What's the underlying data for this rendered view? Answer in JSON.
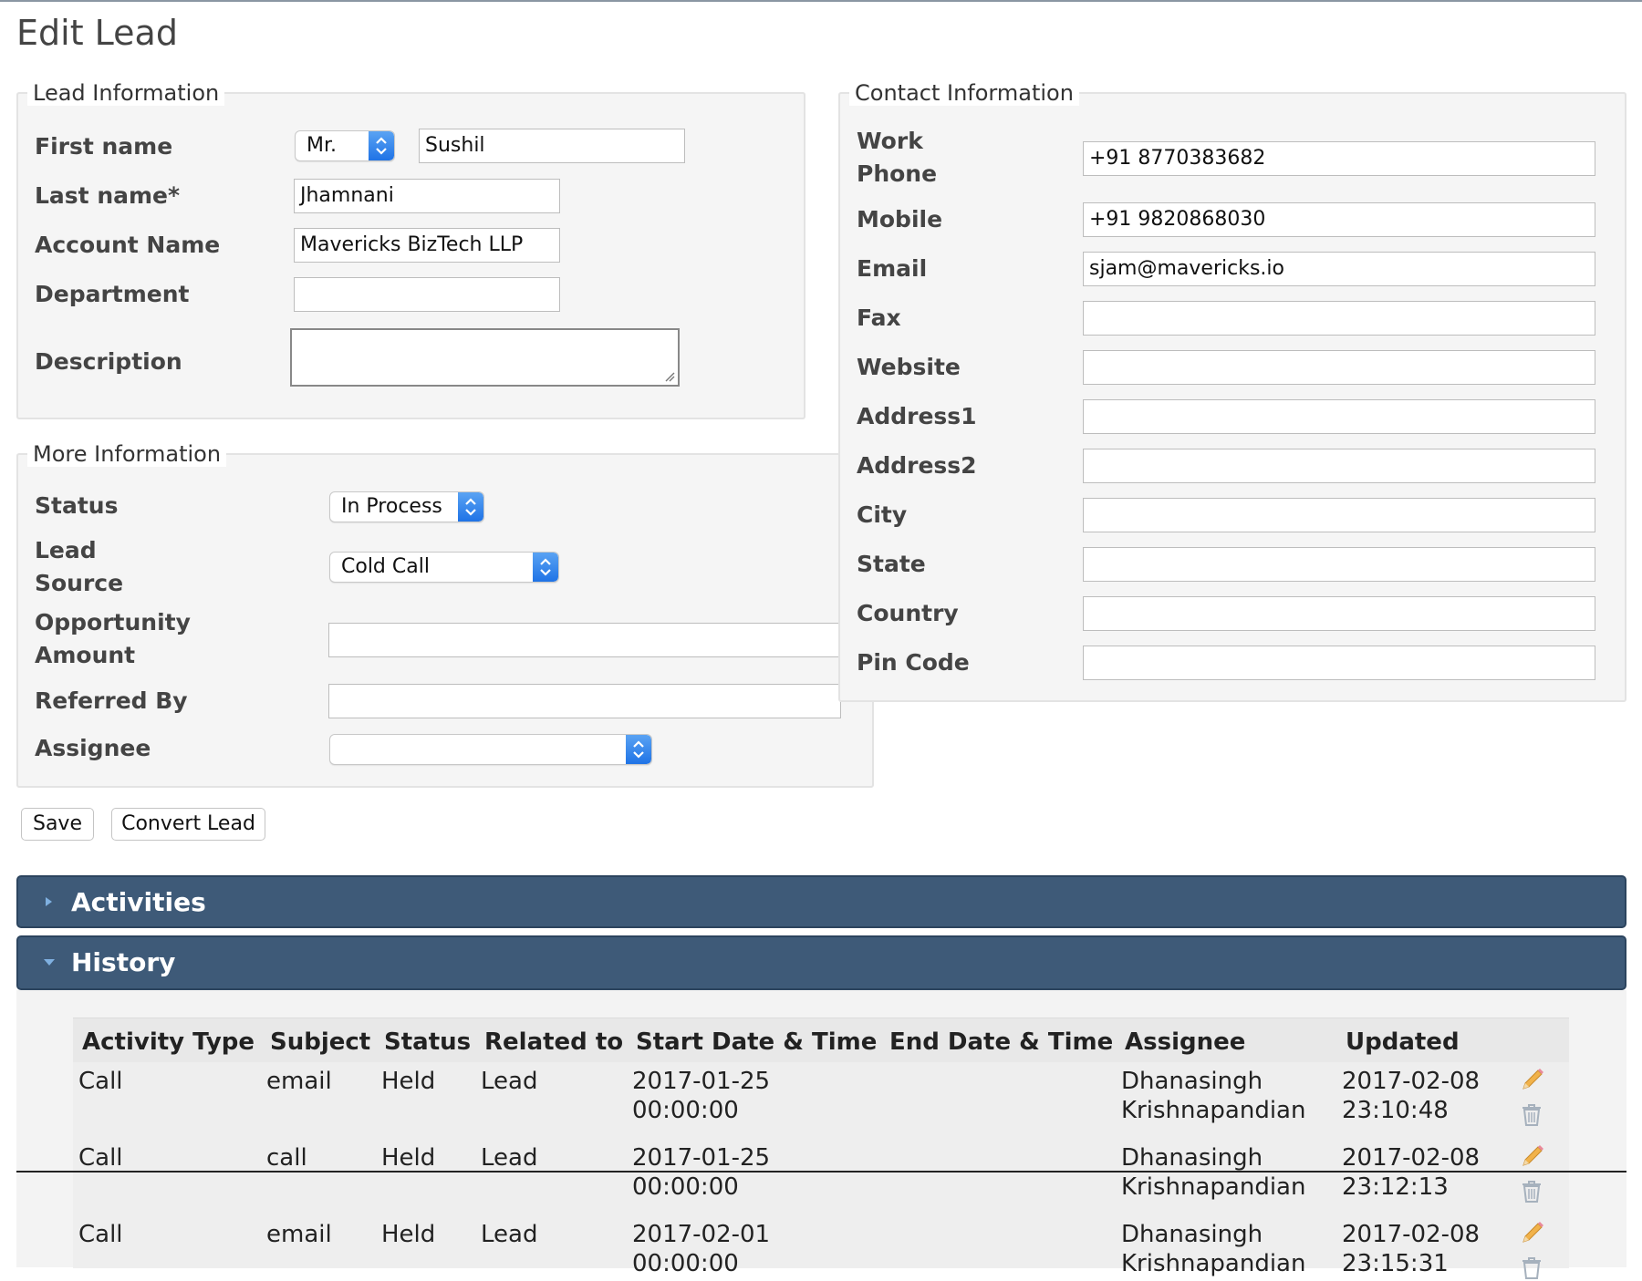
{
  "page": {
    "title": "Edit Lead"
  },
  "lead_info": {
    "legend": "Lead Information",
    "first_name": {
      "label": "First name",
      "salutation": "Mr.",
      "value": "Sushil"
    },
    "last_name": {
      "label": "Last name*",
      "value": "Jhamnani"
    },
    "account_name": {
      "label": "Account Name",
      "value": "Mavericks BizTech LLP"
    },
    "department": {
      "label": "Department",
      "value": ""
    },
    "description": {
      "label": "Description",
      "value": ""
    }
  },
  "more_info": {
    "legend": "More Information",
    "status": {
      "label": "Status",
      "value": "In Process"
    },
    "lead_source": {
      "label_line1": "Lead",
      "label_line2": "Source",
      "value": "Cold Call"
    },
    "opportunity_amount": {
      "label_line1": "Opportunity",
      "label_line2": "Amount",
      "value": ""
    },
    "referred_by": {
      "label": "Referred By",
      "value": ""
    },
    "assignee": {
      "label": "Assignee",
      "value": ""
    }
  },
  "contact_info": {
    "legend": "Contact Information",
    "work_phone": {
      "label_line1": "Work",
      "label_line2": "Phone",
      "value": "+91 8770383682"
    },
    "mobile": {
      "label": "Mobile",
      "value": "+91 9820868030"
    },
    "email": {
      "label": "Email",
      "value": "sjam@mavericks.io"
    },
    "fax": {
      "label": "Fax",
      "value": ""
    },
    "website": {
      "label": "Website",
      "value": ""
    },
    "address1": {
      "label": "Address1",
      "value": ""
    },
    "address2": {
      "label": "Address2",
      "value": ""
    },
    "city": {
      "label": "City",
      "value": ""
    },
    "state": {
      "label": "State",
      "value": ""
    },
    "country": {
      "label": "Country",
      "value": ""
    },
    "pin_code": {
      "label": "Pin Code",
      "value": ""
    }
  },
  "actions": {
    "save": "Save",
    "convert": "Convert Lead"
  },
  "panels": {
    "activities": "Activities",
    "history": "History"
  },
  "history": {
    "columns": [
      "Activity Type",
      "Subject",
      "Status",
      "Related to",
      "Start Date & Time",
      "End Date & Time",
      "Assignee",
      "Updated"
    ],
    "rows": [
      {
        "type": "Call",
        "subject": "email",
        "status": "Held",
        "related": "Lead",
        "start_date": "2017-01-25",
        "start_time": "00:00:00",
        "assignee_first": "Dhanasingh",
        "assignee_last": "Krishnapandian",
        "updated_date": "2017-02-08",
        "updated_time": "23:10:48"
      },
      {
        "type": "Call",
        "subject": "call",
        "status": "Held",
        "related": "Lead",
        "start_date": "2017-01-25",
        "start_time": "00:00:00",
        "assignee_first": "Dhanasingh",
        "assignee_last": "Krishnapandian",
        "updated_date": "2017-02-08",
        "updated_time": "23:12:13"
      },
      {
        "type": "Call",
        "subject": "email",
        "status": "Held",
        "related": "Lead",
        "start_date": "2017-02-01",
        "start_time": "00:00:00",
        "assignee_first": "Dhanasingh",
        "assignee_last": "Krishnapandian",
        "updated_date": "2017-02-08",
        "updated_time": "23:15:31"
      }
    ]
  },
  "colors": {
    "panel_bar": "#3e5a78",
    "select_arrow": "#1f73e6",
    "edit_icon": "#e8a530",
    "fieldset_bg": "#f5f5f5"
  },
  "icons": {
    "edit": "pencil-icon",
    "delete": "trash-icon",
    "expand": "caret-right-icon",
    "collapse": "caret-down-icon"
  }
}
